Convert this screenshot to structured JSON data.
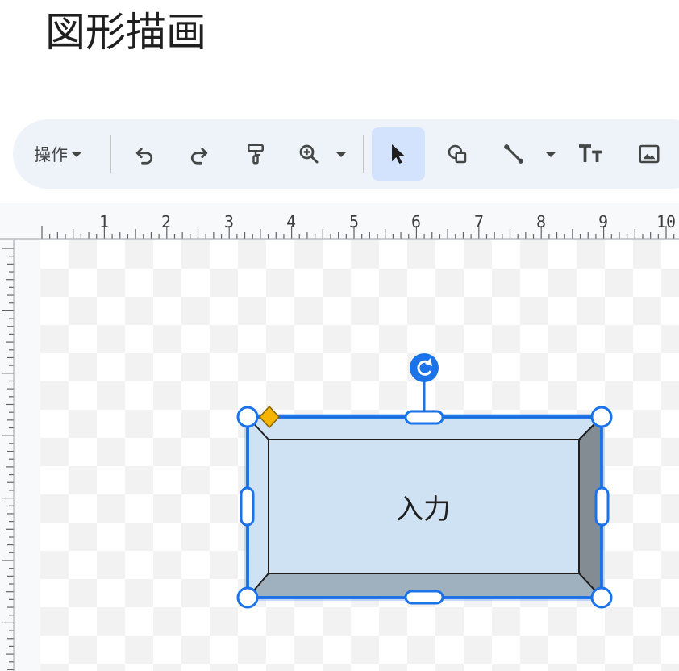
{
  "page": {
    "title": "図形描画"
  },
  "toolbar": {
    "actions_label": "操作",
    "icons": [
      "undo-icon",
      "redo-icon",
      "paint-format-icon",
      "zoom-icon",
      "select-cursor-icon",
      "shape-icon",
      "line-icon",
      "text-box-icon",
      "image-icon"
    ]
  },
  "ruler": {
    "labels": [
      "1",
      "2",
      "3",
      "4",
      "5",
      "6",
      "7",
      "8",
      "9",
      "10"
    ]
  },
  "shape": {
    "label": "入力",
    "fill": "#cfe2f3",
    "bevel_right": "#838b93",
    "bevel_bottom": "#9fb0bf",
    "selection_color": "#1a73e8",
    "adjust_handle_color": "#f4b400"
  },
  "colors": {
    "toolbar_bg": "#eef2f9",
    "select_active_bg": "#d3e3fd"
  }
}
